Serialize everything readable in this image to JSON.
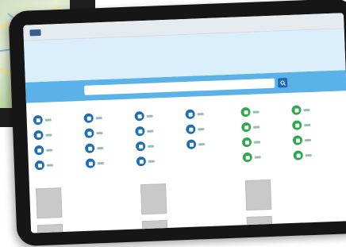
{
  "colors": {
    "accent": "#5bb2e8",
    "hero": "#dbeefb",
    "blue_icon": "#1f6fb2",
    "green_icon": "#2fa84f"
  },
  "nav": {
    "items": [
      "",
      ""
    ],
    "right_items": [
      "",
      ""
    ]
  },
  "hero": {
    "lines": [
      "",
      ""
    ],
    "link": ""
  },
  "search": {
    "placeholder": "",
    "icon": "search-icon"
  },
  "categories": {
    "left_heading": "",
    "right_heading": "",
    "more_links": [
      "",
      ""
    ],
    "left_items": [
      {
        "label": "",
        "icon": "layers-icon"
      },
      {
        "label": "",
        "icon": "globe-icon"
      },
      {
        "label": "",
        "icon": "cloud-icon"
      },
      {
        "label": "",
        "icon": "dots-icon"
      },
      {
        "label": "",
        "icon": "drop-icon"
      },
      {
        "label": "",
        "icon": "tree-icon"
      },
      {
        "label": "",
        "icon": "pin-icon"
      },
      {
        "label": "",
        "icon": "chat-icon"
      },
      {
        "label": "",
        "icon": "factory-icon"
      },
      {
        "label": "",
        "icon": "leaf-icon"
      },
      {
        "label": "",
        "icon": "home-icon"
      },
      {
        "label": "",
        "icon": "cart-icon"
      },
      {
        "label": "",
        "icon": "cloud-icon"
      },
      {
        "label": "",
        "icon": "map-icon"
      },
      {
        "label": "",
        "icon": "truck-icon"
      }
    ],
    "right_items": [
      {
        "label": "",
        "icon": "list-icon"
      },
      {
        "label": "",
        "icon": "leaf-icon"
      },
      {
        "label": "",
        "icon": "chart-icon"
      },
      {
        "label": "",
        "icon": "briefcase-icon"
      },
      {
        "label": "",
        "icon": "grid-icon"
      },
      {
        "label": "",
        "icon": "grid-icon"
      },
      {
        "label": "",
        "icon": "grid-icon"
      },
      {
        "label": "",
        "icon": "bar-chart-icon"
      }
    ]
  },
  "results": [
    {
      "title": "",
      "sub": ""
    },
    {
      "title": "",
      "sub": ""
    },
    {
      "title": "",
      "sub": ""
    },
    {
      "title": "",
      "sub": ""
    },
    {
      "title": "",
      "sub": ""
    },
    {
      "title": "",
      "sub": ""
    }
  ]
}
